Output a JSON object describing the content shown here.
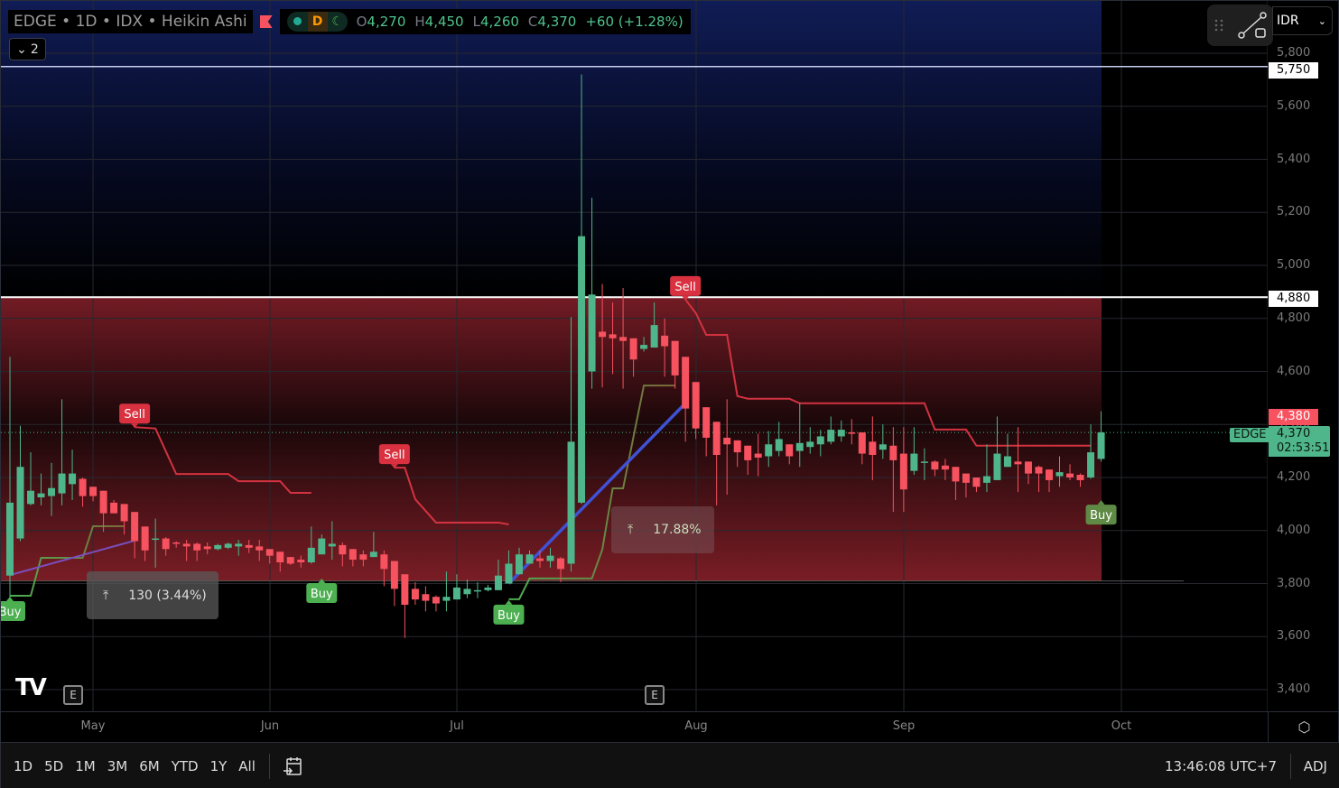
{
  "header": {
    "symbol_title": "EDGE • 1D • IDX • Heikin Ashi",
    "interval_badge": "D",
    "ohlc": {
      "o_label": "O",
      "o": "4,270",
      "h_label": "H",
      "h": "4,450",
      "l_label": "L",
      "l": "4,260",
      "c_label": "C",
      "c": "4,370",
      "change": "+60 (+1.28%)"
    },
    "collapse_count": "2"
  },
  "currency": "IDR",
  "price_axis": {
    "ticks": [
      5800,
      5600,
      5400,
      5200,
      5000,
      4800,
      4600,
      4400,
      4200,
      4000,
      3800,
      3600,
      3400
    ],
    "badges": {
      "line_upper": "5,750",
      "line_lower": "4,880",
      "high_marker": "4,380",
      "symbol": "EDGE",
      "last_price": "4,370",
      "countdown": "02:53:51"
    }
  },
  "time_axis": [
    "May",
    "Jun",
    "Jul",
    "Aug",
    "Sep",
    "Oct"
  ],
  "colors": {
    "up": "#4fb58a",
    "down": "#f7525f",
    "sell": "#d9313f",
    "buy": "#4caf50",
    "buy_line": "#6b7a3a",
    "sell_line": "#d23340",
    "trend": "#3f51d5"
  },
  "measures": [
    {
      "value": "130 (3.44%)"
    },
    {
      "value": "17.88%"
    }
  ],
  "bottom_bar": {
    "ranges": [
      "1D",
      "5D",
      "1M",
      "3M",
      "6M",
      "YTD",
      "1Y",
      "All"
    ],
    "clock": "13:46:08 UTC+7",
    "adj": "ADJ"
  },
  "events_badge": "E",
  "chart_data": {
    "type": "candlestick",
    "style": "Heikin Ashi",
    "ylim": [
      3400,
      5800
    ],
    "horizontal_lines": [
      5750,
      4880
    ],
    "zone": {
      "from": 3810,
      "to": 4880
    },
    "last_price": 4370,
    "candles": [
      [
        3830,
        4655,
        3725,
        4105
      ],
      [
        3970,
        4395,
        3960,
        4240
      ],
      [
        4100,
        4295,
        4095,
        4150
      ],
      [
        4125,
        4215,
        4095,
        4140
      ],
      [
        4130,
        4255,
        4055,
        4160
      ],
      [
        4140,
        4495,
        4095,
        4215
      ],
      [
        4175,
        4305,
        4115,
        4215
      ],
      [
        4195,
        4200,
        4090,
        4130
      ],
      [
        4165,
        4165,
        4110,
        4130
      ],
      [
        4150,
        4150,
        3995,
        4065
      ],
      [
        4105,
        4115,
        4065,
        4065
      ],
      [
        4100,
        4100,
        3985,
        4035
      ],
      [
        4070,
        4070,
        3895,
        3960
      ],
      [
        4015,
        4015,
        3885,
        3925
      ],
      [
        3965,
        4045,
        3860,
        3970
      ],
      [
        3970,
        3975,
        3905,
        3930
      ],
      [
        3955,
        3960,
        3935,
        3950
      ],
      [
        3950,
        3965,
        3885,
        3940
      ],
      [
        3950,
        3955,
        3885,
        3925
      ],
      [
        3940,
        3955,
        3910,
        3930
      ],
      [
        3930,
        3950,
        3925,
        3945
      ],
      [
        3935,
        3955,
        3930,
        3950
      ],
      [
        3940,
        3965,
        3905,
        3950
      ],
      [
        3945,
        3965,
        3915,
        3935
      ],
      [
        3940,
        3965,
        3885,
        3925
      ],
      [
        3930,
        3930,
        3875,
        3905
      ],
      [
        3920,
        3920,
        3845,
        3880
      ],
      [
        3900,
        3900,
        3870,
        3875
      ],
      [
        3890,
        3905,
        3860,
        3880
      ],
      [
        3880,
        4015,
        3875,
        3935
      ],
      [
        3910,
        3985,
        3910,
        3970
      ],
      [
        3940,
        4035,
        3890,
        3950
      ],
      [
        3945,
        3955,
        3865,
        3910
      ],
      [
        3930,
        3930,
        3865,
        3890
      ],
      [
        3910,
        3925,
        3865,
        3890
      ],
      [
        3900,
        3995,
        3900,
        3920
      ],
      [
        3910,
        3925,
        3790,
        3855
      ],
      [
        3885,
        3885,
        3715,
        3780
      ],
      [
        3835,
        3835,
        3595,
        3720
      ],
      [
        3780,
        3805,
        3720,
        3740
      ],
      [
        3760,
        3790,
        3695,
        3735
      ],
      [
        3750,
        3755,
        3695,
        3725
      ],
      [
        3735,
        3845,
        3695,
        3750
      ],
      [
        3740,
        3835,
        3740,
        3785
      ],
      [
        3760,
        3815,
        3745,
        3780
      ],
      [
        3775,
        3805,
        3745,
        3775
      ],
      [
        3775,
        3795,
        3770,
        3785
      ],
      [
        3775,
        3890,
        3775,
        3830
      ],
      [
        3800,
        3925,
        3800,
        3875
      ],
      [
        3835,
        3935,
        3835,
        3910
      ],
      [
        3875,
        3925,
        3875,
        3910
      ],
      [
        3895,
        3925,
        3860,
        3885
      ],
      [
        3885,
        3935,
        3860,
        3905
      ],
      [
        3895,
        3900,
        3805,
        3855
      ],
      [
        3875,
        4805,
        3845,
        4335
      ],
      [
        4105,
        5720,
        4100,
        5110
      ],
      [
        4600,
        5255,
        4535,
        4890
      ],
      [
        4750,
        4930,
        4540,
        4730
      ],
      [
        4740,
        4860,
        4590,
        4725
      ],
      [
        4730,
        4915,
        4535,
        4715
      ],
      [
        4725,
        4725,
        4580,
        4645
      ],
      [
        4685,
        4730,
        4675,
        4700
      ],
      [
        4690,
        4860,
        4690,
        4775
      ],
      [
        4735,
        4800,
        4580,
        4695
      ],
      [
        4715,
        4715,
        4535,
        4585
      ],
      [
        4655,
        4655,
        4335,
        4460
      ],
      [
        4560,
        4560,
        4345,
        4385
      ],
      [
        4465,
        4465,
        4280,
        4350
      ],
      [
        4410,
        4410,
        4095,
        4285
      ],
      [
        4350,
        4495,
        4135,
        4325
      ],
      [
        4340,
        4340,
        4240,
        4295
      ],
      [
        4320,
        4320,
        4210,
        4265
      ],
      [
        4290,
        4365,
        4205,
        4275
      ],
      [
        4280,
        4375,
        4240,
        4325
      ],
      [
        4300,
        4410,
        4280,
        4345
      ],
      [
        4325,
        4325,
        4250,
        4280
      ],
      [
        4300,
        4480,
        4240,
        4330
      ],
      [
        4315,
        4390,
        4290,
        4335
      ],
      [
        4325,
        4380,
        4280,
        4355
      ],
      [
        4335,
        4430,
        4325,
        4380
      ],
      [
        4355,
        4415,
        4335,
        4380
      ],
      [
        4370,
        4420,
        4325,
        4365
      ],
      [
        4370,
        4370,
        4250,
        4290
      ],
      [
        4335,
        4430,
        4190,
        4285
      ],
      [
        4305,
        4400,
        4270,
        4325
      ],
      [
        4320,
        4390,
        4070,
        4265
      ],
      [
        4290,
        4390,
        4070,
        4155
      ],
      [
        4225,
        4390,
        4210,
        4290
      ],
      [
        4255,
        4310,
        4190,
        4260
      ],
      [
        4260,
        4265,
        4205,
        4230
      ],
      [
        4245,
        4270,
        4190,
        4230
      ],
      [
        4240,
        4240,
        4115,
        4185
      ],
      [
        4215,
        4215,
        4125,
        4180
      ],
      [
        4200,
        4200,
        4145,
        4165
      ],
      [
        4180,
        4325,
        4145,
        4205
      ],
      [
        4190,
        4430,
        4190,
        4290
      ],
      [
        4240,
        4365,
        4240,
        4280
      ],
      [
        4260,
        4390,
        4145,
        4250
      ],
      [
        4260,
        4260,
        4175,
        4215
      ],
      [
        4240,
        4245,
        4145,
        4215
      ],
      [
        4230,
        4230,
        4145,
        4190
      ],
      [
        4205,
        4280,
        4165,
        4220
      ],
      [
        4215,
        4250,
        4190,
        4200
      ],
      [
        4210,
        4215,
        4165,
        4190
      ],
      [
        4200,
        4400,
        4195,
        4295
      ],
      [
        4270,
        4450,
        4260,
        4370
      ]
    ],
    "sell_stop_line": [
      [
        [
          12,
          4390
        ],
        [
          14,
          4385
        ],
        [
          16,
          4213
        ],
        [
          21,
          4213
        ],
        [
          22,
          4186
        ],
        [
          26,
          4186
        ],
        [
          27,
          4142
        ],
        [
          29,
          4142
        ]
      ],
      [
        [
          37,
          4237
        ],
        [
          38,
          4237
        ],
        [
          39,
          4118
        ],
        [
          41,
          4030
        ],
        [
          47,
          4030
        ],
        [
          48,
          4023
        ]
      ],
      [
        [
          65,
          4871
        ],
        [
          66,
          4820
        ],
        [
          67,
          4738
        ],
        [
          69,
          4738
        ],
        [
          70,
          4507
        ],
        [
          71,
          4497
        ],
        [
          75,
          4497
        ],
        [
          76,
          4480
        ],
        [
          88,
          4480
        ],
        [
          89,
          4381
        ],
        [
          92,
          4381
        ],
        [
          93,
          4320
        ],
        [
          104,
          4320
        ]
      ]
    ],
    "buy_stop_line": [
      [
        [
          0,
          3754
        ],
        [
          2,
          3754
        ],
        [
          3,
          3897
        ],
        [
          7,
          3897
        ],
        [
          8,
          4016
        ],
        [
          11,
          4016
        ]
      ],
      [
        [
          30,
          3822
        ],
        [
          36,
          3822
        ]
      ],
      [
        [
          48,
          3741
        ],
        [
          49,
          3741
        ],
        [
          50,
          3819
        ],
        [
          56,
          3819
        ],
        [
          57,
          3928
        ],
        [
          58,
          4159
        ],
        [
          59,
          4159
        ],
        [
          61,
          4547
        ],
        [
          64,
          4547
        ]
      ]
    ],
    "trend_lines": [
      {
        "color": "purple",
        "from": [
          0,
          3832
        ],
        "to": [
          12,
          3962
        ]
      },
      {
        "color": "blue",
        "from": [
          48,
          3800
        ],
        "to": [
          65,
          4480
        ]
      }
    ],
    "signals": [
      {
        "label": "Sell",
        "index": 12,
        "price": 4390
      },
      {
        "label": "Sell",
        "index": 37,
        "price": 4237
      },
      {
        "label": "Sell",
        "index": 65,
        "price": 4871
      },
      {
        "label": "Buy",
        "index": 0,
        "price": 3754
      },
      {
        "label": "Buy",
        "index": 30,
        "price": 3822
      },
      {
        "label": "Buy",
        "index": 48,
        "price": 3741
      },
      {
        "label": "Buy",
        "index": 105,
        "price": 4118
      }
    ]
  }
}
